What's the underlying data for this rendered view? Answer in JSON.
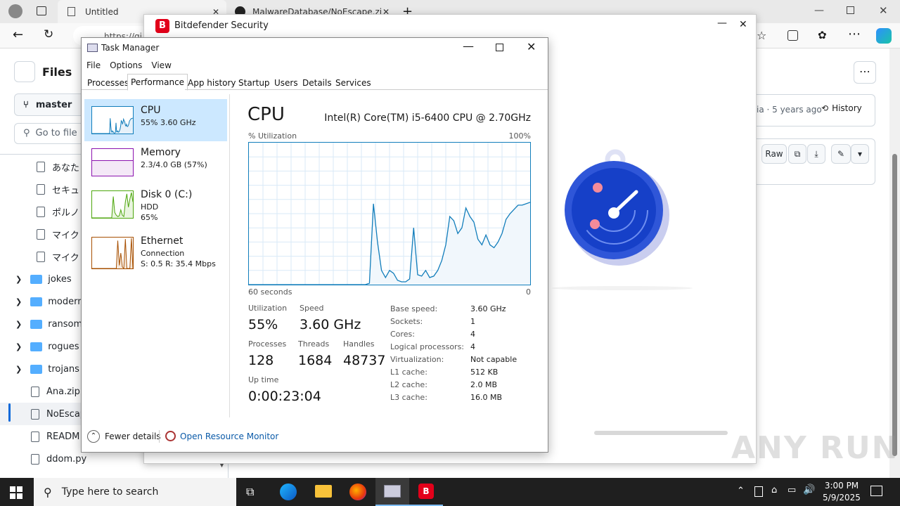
{
  "browser": {
    "tabs": [
      {
        "title": "Untitled"
      },
      {
        "title": "MalwareDatabase/NoEscape.zip"
      }
    ],
    "address": "https://gi"
  },
  "github": {
    "files_title": "Files",
    "branch": "master",
    "goto_placeholder": "Go to file",
    "meta": "ia · 5 years ago",
    "history_label": "History",
    "raw_label": "Raw",
    "tree": [
      {
        "type": "file",
        "name": "あなた"
      },
      {
        "type": "file",
        "name": "セキュ"
      },
      {
        "type": "file",
        "name": "ポルノ"
      },
      {
        "type": "file",
        "name": "マイク"
      },
      {
        "type": "file",
        "name": "マイク"
      },
      {
        "type": "folder",
        "name": "jokes"
      },
      {
        "type": "folder",
        "name": "modern"
      },
      {
        "type": "folder",
        "name": "ransom"
      },
      {
        "type": "folder",
        "name": "rogues"
      },
      {
        "type": "folder",
        "name": "trojans"
      },
      {
        "type": "file",
        "name": "Ana.zip"
      },
      {
        "type": "file",
        "name": "NoEscap"
      },
      {
        "type": "file",
        "name": "READM"
      },
      {
        "type": "file",
        "name": "ddom.py"
      }
    ]
  },
  "bitdefender": {
    "title": "Bitdefender Security",
    "logo_letter": "B"
  },
  "taskmanager": {
    "title": "Task Manager",
    "menu": [
      "File",
      "Options",
      "View"
    ],
    "tabs": [
      "Processes",
      "Performance",
      "App history",
      "Startup",
      "Users",
      "Details",
      "Services"
    ],
    "active_tab": "Performance",
    "side": [
      {
        "name": "CPU",
        "line1": "55% 3.60 GHz",
        "line2": "",
        "color": "#117dbb"
      },
      {
        "name": "Memory",
        "line1": "2.3/4.0 GB (57%)",
        "line2": "",
        "color": "#8b12ae"
      },
      {
        "name": "Disk 0 (C:)",
        "line1": "HDD",
        "line2": "65%",
        "color": "#4da60c"
      },
      {
        "name": "Ethernet",
        "line1": "Connection",
        "line2": "S: 0.5 R: 35.4 Mbps",
        "color": "#a74f01"
      }
    ],
    "cpu": {
      "heading": "CPU",
      "model": "Intel(R) Core(TM) i5-6400 CPU @ 2.70GHz",
      "util_label": "% Utilization",
      "max_label": "100%",
      "time_label": "60 seconds",
      "zero_label": "0",
      "stats": {
        "utilization_label": "Utilization",
        "utilization": "55%",
        "speed_label": "Speed",
        "speed": "3.60 GHz",
        "processes_label": "Processes",
        "processes": "128",
        "threads_label": "Threads",
        "threads": "1684",
        "handles_label": "Handles",
        "handles": "48737",
        "uptime_label": "Up time",
        "uptime": "0:00:23:04"
      },
      "specs": [
        {
          "k": "Base speed:",
          "v": "3.60 GHz"
        },
        {
          "k": "Sockets:",
          "v": "1"
        },
        {
          "k": "Cores:",
          "v": "4"
        },
        {
          "k": "Logical processors:",
          "v": "4"
        },
        {
          "k": "Virtualization:",
          "v": "Not capable"
        },
        {
          "k": "L1 cache:",
          "v": "512 KB"
        },
        {
          "k": "L2 cache:",
          "v": "2.0 MB"
        },
        {
          "k": "L3 cache:",
          "v": "16.0 MB"
        }
      ],
      "graph": [
        0,
        0,
        0,
        0,
        0,
        0,
        0,
        0,
        0,
        0,
        0,
        0,
        0,
        0,
        0,
        0,
        0,
        0,
        0,
        0,
        0,
        0,
        0,
        0,
        0,
        0,
        0,
        0,
        0,
        0,
        1,
        57,
        30,
        10,
        5,
        10,
        8,
        3,
        2,
        2,
        4,
        40,
        7,
        6,
        10,
        5,
        6,
        10,
        17,
        28,
        48,
        45,
        36,
        40,
        54,
        48,
        44,
        32,
        28,
        35,
        28,
        26,
        30,
        36,
        46,
        50,
        53,
        56,
        56,
        57,
        58
      ]
    },
    "footer": {
      "fewer": "Fewer details",
      "resmon": "Open Resource Monitor"
    }
  },
  "taskbar": {
    "search_placeholder": "Type here to search",
    "time": "3:00 PM",
    "date": "5/9/2025"
  },
  "watermark": "ANY RUN"
}
